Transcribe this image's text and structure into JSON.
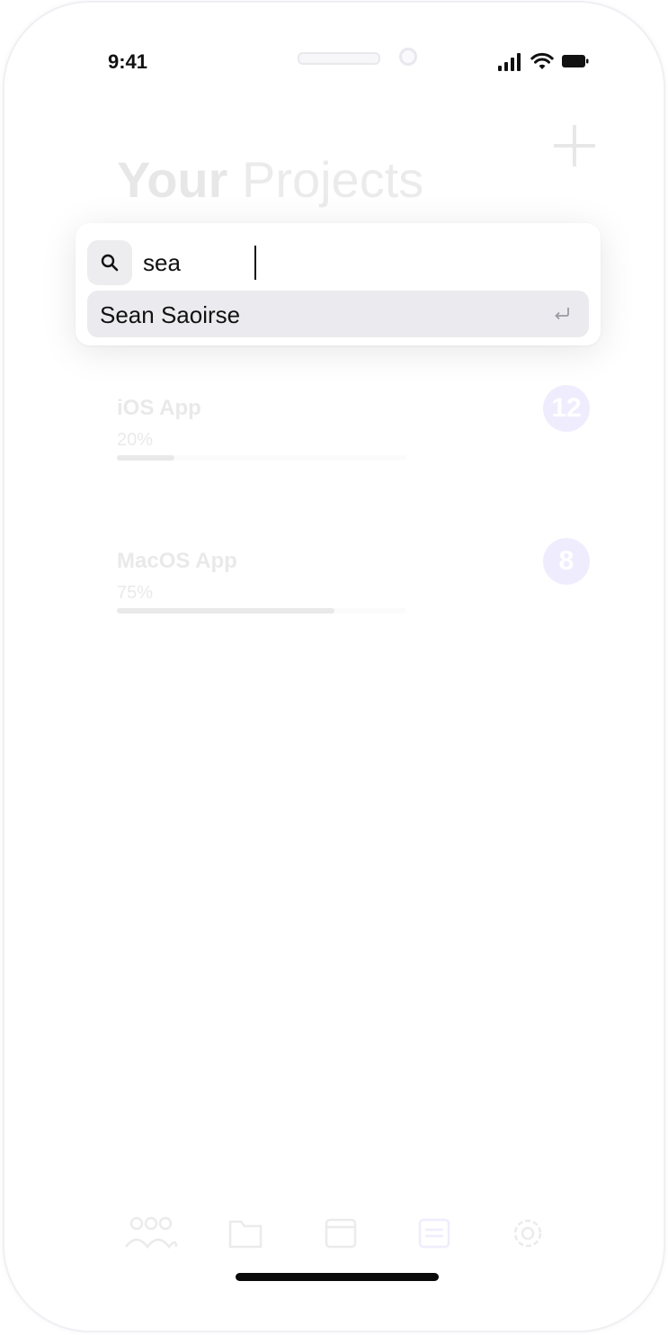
{
  "status_bar": {
    "time": "9:41"
  },
  "page": {
    "title_bold": "Your",
    "title_light": "Projects"
  },
  "projects": [
    {
      "name": "iOS App",
      "progress_label": "20%",
      "progress": 0.2,
      "count": "12"
    },
    {
      "name": "MacOS App",
      "progress_label": "75%",
      "progress": 0.75,
      "count": "8"
    }
  ],
  "search": {
    "query": "sea",
    "results": [
      {
        "label": "Sean Saoirse"
      }
    ]
  },
  "tab_bar": {
    "items": [
      "team-icon",
      "folder-icon",
      "calendar-icon",
      "board-icon",
      "settings-icon"
    ]
  },
  "colors": {
    "accent": "#5a4ee6",
    "text": "#111111",
    "panel": "#ffffff",
    "row_highlight": "#ebebef"
  }
}
